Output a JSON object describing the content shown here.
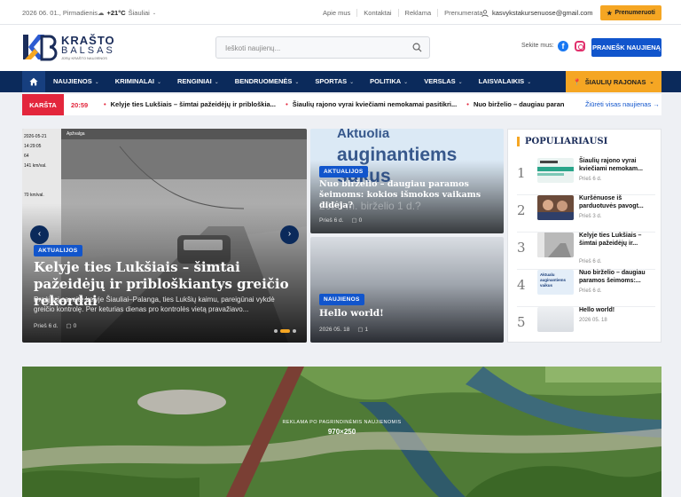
{
  "topbar": {
    "date": "2026 06. 01., Pirmadienis",
    "temperature": "+21°C",
    "city": "Šiauliai",
    "links": [
      "Apie mus",
      "Kontaktai",
      "Reklama",
      "Prenumerata"
    ],
    "email": "kasvykstakursenuose@gmail.com",
    "subscribe": "Prenumeruoti"
  },
  "header": {
    "logo_line1": "KRAŠTO",
    "logo_line2": "BALSAS",
    "logo_tagline": "JŪSŲ KRAŠTO NAUJIENOS",
    "search_placeholder": "Ieškoti naujienų...",
    "follow_label": "Sekite mus:",
    "report_button": "PRANEŠK NAUJIENĄ"
  },
  "nav": {
    "items": [
      "NAUJIENOS",
      "KRIMINALAI",
      "RENGINIAI",
      "BENDRUOMENĖS",
      "SPORTAS",
      "POLITIKA",
      "VERSLAS",
      "LAISVALAIKIS"
    ],
    "region": "ŠIAULIŲ RAJONAS"
  },
  "ticker": {
    "label": "KARŠTA",
    "time": "20:59",
    "items": [
      "Kelyje ties Lukšiais – šimtai pažeidėjų ir pribloškia...",
      "Šiaulių rajono vyrai kviečiami nemokamai pasitikri...",
      "Nuo birželio – daugiau paran"
    ],
    "all_link": "Žiūrėti visas naujienas →"
  },
  "featured": {
    "badge": "AKTUALIJOS",
    "title": "Kelyje ties Lukšiais – šimtai pažeidėjų ir pribloškiantys greičio rekordai",
    "excerpt": "Praėjusį savaitę kelyje Šiauliai–Palanga, ties Lukšių kaimu, pareigūnai vykdė greičio kontrolę. Per keturias dienas pro kontrolės vietą pravažiavo...",
    "time": "Prieš 6 d.",
    "comments": "0",
    "camera_overlay": {
      "date": "2026-05-21",
      "clock": "14:29:05",
      "lane": "64",
      "speed": "141 km/val.",
      "limit": "70 km/val.",
      "place": "Apžvalga"
    }
  },
  "side_top": {
    "image_text_1": "Aktuolia",
    "image_text_2": "auginantiems",
    "image_text_3": "šukus",
    "image_text_4": "2026 m. birželio 1 d.?",
    "badge": "AKTUALIJOS",
    "title": "Nuo birželio – daugiau paramos šeimoms: kokios išmokos vaikams didėja?",
    "time": "Prieš 6 d.",
    "comments": "0"
  },
  "side_bottom": {
    "badge": "NAUJIENOS",
    "title": "Hello world!",
    "time": "2026 05. 18",
    "comments": "1"
  },
  "popular": {
    "heading": "POPULIARIAUSI",
    "items": [
      {
        "num": "1",
        "title": "Šiaulių rajono vyrai kviečiami nemokam...",
        "time": "Prieš 6 d."
      },
      {
        "num": "2",
        "title": "Kuršėnuose iš parduotuvės pavogt...",
        "time": "Prieš 3 d."
      },
      {
        "num": "3",
        "title": "Kelyje ties Lukšiais – šimtai pažeidėjų ir...",
        "time": "Prieš 6 d."
      },
      {
        "num": "4",
        "title": "Nuo birželio – daugiau paramos šeimoms:...",
        "time": "Prieš 6 d."
      },
      {
        "num": "5",
        "title": "Hello world!",
        "time": "2026 05. 18"
      }
    ],
    "thumb4_text": "Aktualu auginantiems vaikus"
  },
  "banner": {
    "label": "REKLAMA PO PAGRINDINĖMIS NAUJIENOMIS",
    "size": "970×250"
  },
  "colors": {
    "navy": "#0b2a5b",
    "accent_orange": "#f5a623",
    "accent_blue": "#1155cc",
    "hot_red": "#e3263c"
  }
}
